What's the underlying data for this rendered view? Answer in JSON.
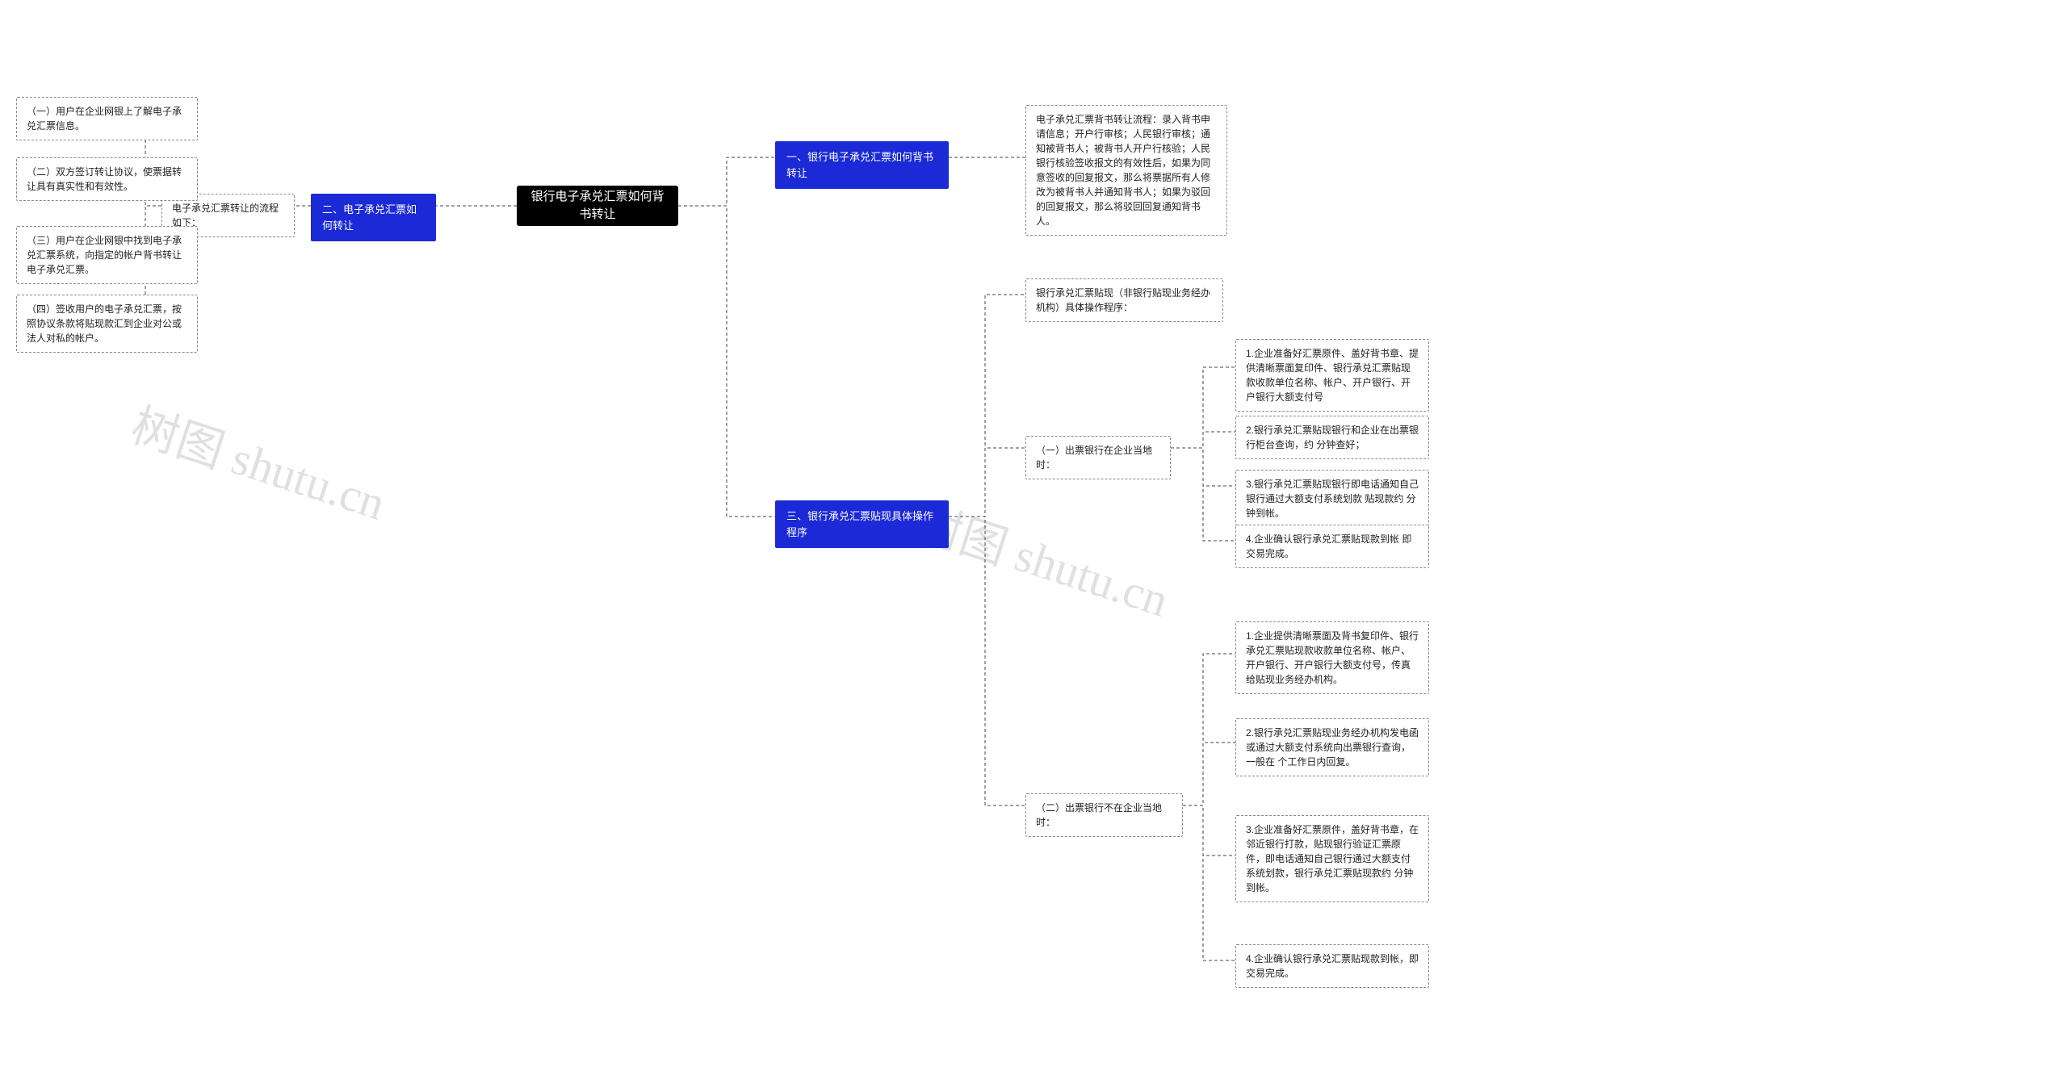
{
  "center": {
    "title": "银行电子承兑汇票如何背书转让"
  },
  "watermarks": {
    "left": "树图 shutu.cn",
    "right": "树图 shutu.cn"
  },
  "right": {
    "section1": {
      "title": "一、银行电子承兑汇票如何背书转让",
      "content": "电子承兑汇票背书转让流程：录入背书申请信息；开户行审核；人民银行审核；通知被背书人；被背书人开户行核验；人民银行核验签收报文的有效性后，如果为同意签收的回复报文，那么将票据所有人修改为被背书人并通知背书人；如果为驳回的回复报文，那么将驳回回复通知背书人。"
    },
    "section3": {
      "title": "三、银行承兑汇票贴现具体操作程序",
      "intro": "银行承兑汇票贴现（非银行贴现业务经办机构）具体操作程序：",
      "grp1": {
        "title": "（一）出票银行在企业当地时：",
        "items": [
          "1.企业准备好汇票原件、盖好背书章、提供清晰票面复印件、银行承兑汇票贴现款收款单位名称、帐户、开户银行、开户银行大额支付号",
          "2.银行承兑汇票贴现银行和企业在出票银行柜台查询，约 分钟查好；",
          "3.银行承兑汇票贴现银行即电话通知自己银行通过大额支付系统划款 贴现款约 分钟到帐。",
          "4.企业确认银行承兑汇票贴现款到帐 即交易完成。"
        ]
      },
      "grp2": {
        "title": "（二）出票银行不在企业当地时：",
        "items": [
          "1.企业提供清晰票面及背书复印件、银行承兑汇票贴现款收款单位名称、帐户、开户银行、开户银行大额支付号，传真给贴现业务经办机构。",
          "2.银行承兑汇票贴现业务经办机构发电函或通过大额支付系统向出票银行查询，一般在 个工作日内回复。",
          "3.企业准备好汇票原件，盖好背书章，在邻近银行打款，贴现银行验证汇票原件，即电话通知自己银行通过大额支付系统划款，银行承兑汇票贴现款约 分钟到帐。",
          "4.企业确认银行承兑汇票贴现款到帐，即交易完成。"
        ]
      }
    }
  },
  "left": {
    "section2": {
      "title": "二、电子承兑汇票如何转让",
      "intro": "电子承兑汇票转让的流程如下：",
      "items": [
        "（一）用户在企业网银上了解电子承兑汇票信息。",
        "（二）双方签订转让协议，使票据转让具有真实性和有效性。",
        "（三）用户在企业网银中找到电子承兑汇票系统，向指定的帐户背书转让电子承兑汇票。",
        "（四）签收用户的电子承兑汇票，按照协议条款将贴现款汇到企业对公或法人对私的帐户。"
      ]
    }
  },
  "chart_data": {
    "type": "mindmap",
    "root": "银行电子承兑汇票如何背书转让",
    "branches": [
      {
        "side": "right",
        "label": "一、银行电子承兑汇票如何背书转让",
        "children": [
          {
            "label": "电子承兑汇票背书转让流程：录入背书申请信息；开户行审核；人民银行审核；通知被背书人；被背书人开户行核验；人民银行核验签收报文的有效性后，如果为同意签收的回复报文，那么将票据所有人修改为被背书人并通知背书人；如果为驳回的回复报文，那么将驳回回复通知背书人。"
          }
        ]
      },
      {
        "side": "right",
        "label": "三、银行承兑汇票贴现具体操作程序",
        "children": [
          {
            "label": "银行承兑汇票贴现（非银行贴现业务经办机构）具体操作程序："
          },
          {
            "label": "（一）出票银行在企业当地时：",
            "children": [
              {
                "label": "1.企业准备好汇票原件、盖好背书章、提供清晰票面复印件、银行承兑汇票贴现款收款单位名称、帐户、开户银行、开户银行大额支付号"
              },
              {
                "label": "2.银行承兑汇票贴现银行和企业在出票银行柜台查询，约 分钟查好；"
              },
              {
                "label": "3.银行承兑汇票贴现银行即电话通知自己银行通过大额支付系统划款 贴现款约 分钟到帐。"
              },
              {
                "label": "4.企业确认银行承兑汇票贴现款到帐 即交易完成。"
              }
            ]
          },
          {
            "label": "（二）出票银行不在企业当地时：",
            "children": [
              {
                "label": "1.企业提供清晰票面及背书复印件、银行承兑汇票贴现款收款单位名称、帐户、开户银行、开户银行大额支付号，传真给贴现业务经办机构。"
              },
              {
                "label": "2.银行承兑汇票贴现业务经办机构发电函或通过大额支付系统向出票银行查询，一般在 个工作日内回复。"
              },
              {
                "label": "3.企业准备好汇票原件，盖好背书章，在邻近银行打款，贴现银行验证汇票原件，即电话通知自己银行通过大额支付系统划款，银行承兑汇票贴现款约 分钟到帐。"
              },
              {
                "label": "4.企业确认银行承兑汇票贴现款到帐，即交易完成。"
              }
            ]
          }
        ]
      },
      {
        "side": "left",
        "label": "二、电子承兑汇票如何转让",
        "children": [
          {
            "label": "电子承兑汇票转让的流程如下：",
            "children": [
              {
                "label": "（一）用户在企业网银上了解电子承兑汇票信息。"
              },
              {
                "label": "（二）双方签订转让协议，使票据转让具有真实性和有效性。"
              },
              {
                "label": "（三）用户在企业网银中找到电子承兑汇票系统，向指定的帐户背书转让电子承兑汇票。"
              },
              {
                "label": "（四）签收用户的电子承兑汇票，按照协议条款将贴现款汇到企业对公或法人对私的帐户。"
              }
            ]
          }
        ]
      }
    ]
  }
}
